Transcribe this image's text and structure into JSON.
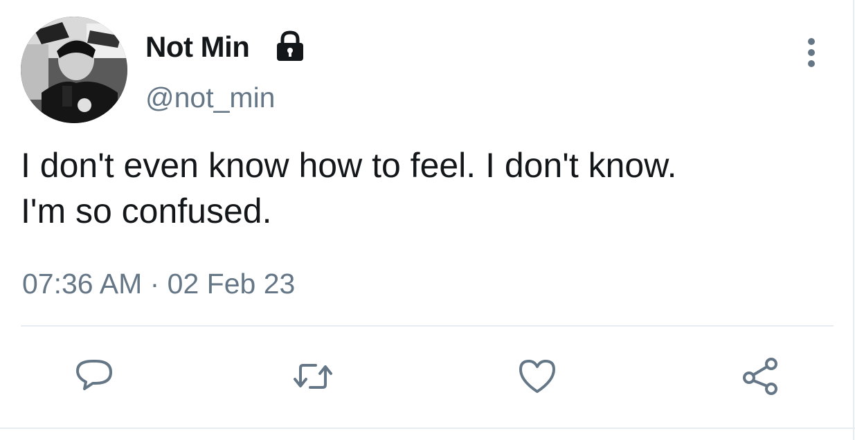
{
  "author": {
    "display_name": "Not Min",
    "handle": "@not_min",
    "avatar": "avatar-photo",
    "protected_icon": "lock-icon"
  },
  "tweet": {
    "text_lines": [
      "I don't even know how to feel. I don't know.",
      "I'm so confused."
    ],
    "timestamp": "07:36 AM · 02 Feb 23"
  },
  "actions": {
    "reply_icon": "reply-icon",
    "retweet_icon": "retweet-icon",
    "like_icon": "heart-icon",
    "share_icon": "share-icon",
    "more_icon": "more-vertical-icon"
  },
  "colors": {
    "text": "#14171a",
    "secondary": "#657786",
    "divider": "#e6ecf0"
  }
}
